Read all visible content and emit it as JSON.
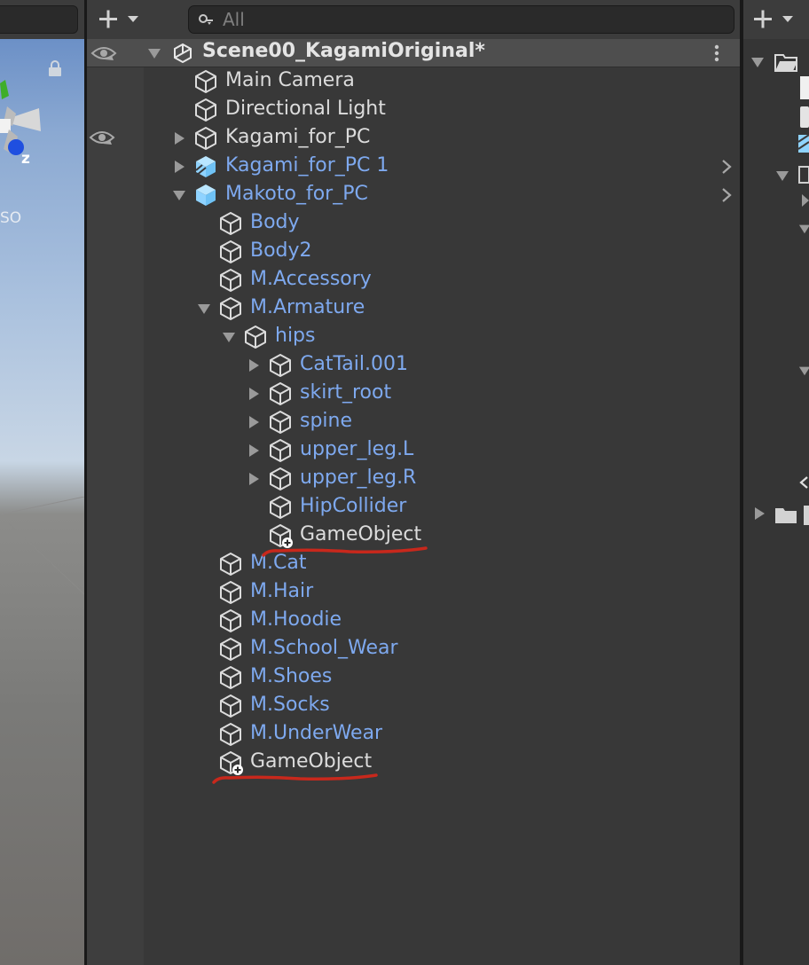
{
  "search": {
    "placeholder": "All"
  },
  "scene_view": {
    "axis_label": "z",
    "persp_label": "SO"
  },
  "hierarchy": {
    "scene_name": "Scene00_KagamiOriginal*",
    "rows": [
      {
        "label": "Main Camera",
        "color": "white",
        "depth": 0,
        "expander": "none",
        "icon": "cube-icon",
        "eye": false,
        "chevron": false
      },
      {
        "label": "Directional Light",
        "color": "white",
        "depth": 0,
        "expander": "none",
        "icon": "cube-icon",
        "eye": false,
        "chevron": false
      },
      {
        "label": "Kagami_for_PC",
        "color": "white",
        "depth": 0,
        "expander": "collapsed",
        "icon": "cube-icon",
        "eye": true,
        "chevron": false
      },
      {
        "label": "Kagami_for_PC 1",
        "color": "blue",
        "depth": 0,
        "expander": "collapsed",
        "icon": "prefab-variant-icon",
        "eye": false,
        "chevron": true
      },
      {
        "label": "Makoto_for_PC",
        "color": "blue",
        "depth": 0,
        "expander": "expanded",
        "icon": "prefab-icon",
        "eye": false,
        "chevron": true
      },
      {
        "label": "Body",
        "color": "blue",
        "depth": 1,
        "expander": "none",
        "icon": "cube-icon",
        "eye": false,
        "chevron": false
      },
      {
        "label": "Body2",
        "color": "blue",
        "depth": 1,
        "expander": "none",
        "icon": "cube-icon",
        "eye": false,
        "chevron": false
      },
      {
        "label": "M.Accessory",
        "color": "blue",
        "depth": 1,
        "expander": "none",
        "icon": "cube-icon",
        "eye": false,
        "chevron": false
      },
      {
        "label": "M.Armature",
        "color": "blue",
        "depth": 1,
        "expander": "expanded",
        "icon": "cube-icon",
        "eye": false,
        "chevron": false
      },
      {
        "label": "hips",
        "color": "blue",
        "depth": 2,
        "expander": "expanded",
        "icon": "cube-icon",
        "eye": false,
        "chevron": false
      },
      {
        "label": "CatTail.001",
        "color": "blue",
        "depth": 3,
        "expander": "collapsed",
        "icon": "cube-icon",
        "eye": false,
        "chevron": false
      },
      {
        "label": "skirt_root",
        "color": "blue",
        "depth": 3,
        "expander": "collapsed",
        "icon": "cube-icon",
        "eye": false,
        "chevron": false
      },
      {
        "label": "spine",
        "color": "blue",
        "depth": 3,
        "expander": "collapsed",
        "icon": "cube-icon",
        "eye": false,
        "chevron": false
      },
      {
        "label": "upper_leg.L",
        "color": "blue",
        "depth": 3,
        "expander": "collapsed",
        "icon": "cube-icon",
        "eye": false,
        "chevron": false
      },
      {
        "label": "upper_leg.R",
        "color": "blue",
        "depth": 3,
        "expander": "collapsed",
        "icon": "cube-icon",
        "eye": false,
        "chevron": false
      },
      {
        "label": "HipCollider",
        "color": "blue",
        "depth": 3,
        "expander": "none",
        "icon": "cube-icon",
        "eye": false,
        "chevron": false
      },
      {
        "label": "GameObject",
        "color": "white",
        "depth": 3,
        "expander": "none",
        "icon": "cube-added-icon",
        "eye": false,
        "chevron": false,
        "annotated": true
      },
      {
        "label": "M.Cat",
        "color": "blue",
        "depth": 1,
        "expander": "none",
        "icon": "cube-icon",
        "eye": false,
        "chevron": false
      },
      {
        "label": "M.Hair",
        "color": "blue",
        "depth": 1,
        "expander": "none",
        "icon": "cube-icon",
        "eye": false,
        "chevron": false
      },
      {
        "label": "M.Hoodie",
        "color": "blue",
        "depth": 1,
        "expander": "none",
        "icon": "cube-icon",
        "eye": false,
        "chevron": false
      },
      {
        "label": "M.School_Wear",
        "color": "blue",
        "depth": 1,
        "expander": "none",
        "icon": "cube-icon",
        "eye": false,
        "chevron": false
      },
      {
        "label": "M.Shoes",
        "color": "blue",
        "depth": 1,
        "expander": "none",
        "icon": "cube-icon",
        "eye": false,
        "chevron": false
      },
      {
        "label": "M.Socks",
        "color": "blue",
        "depth": 1,
        "expander": "none",
        "icon": "cube-icon",
        "eye": false,
        "chevron": false
      },
      {
        "label": "M.UnderWear",
        "color": "blue",
        "depth": 1,
        "expander": "none",
        "icon": "cube-icon",
        "eye": false,
        "chevron": false
      },
      {
        "label": "GameObject",
        "color": "white",
        "depth": 1,
        "expander": "none",
        "icon": "cube-added-icon",
        "eye": false,
        "chevron": false,
        "annotated": true
      }
    ]
  },
  "colors": {
    "text_white": "#dcdcdc",
    "text_blue": "#7ea9ef",
    "prefab_icon": "#8fd3ff",
    "annotation_red": "#c8281c"
  }
}
